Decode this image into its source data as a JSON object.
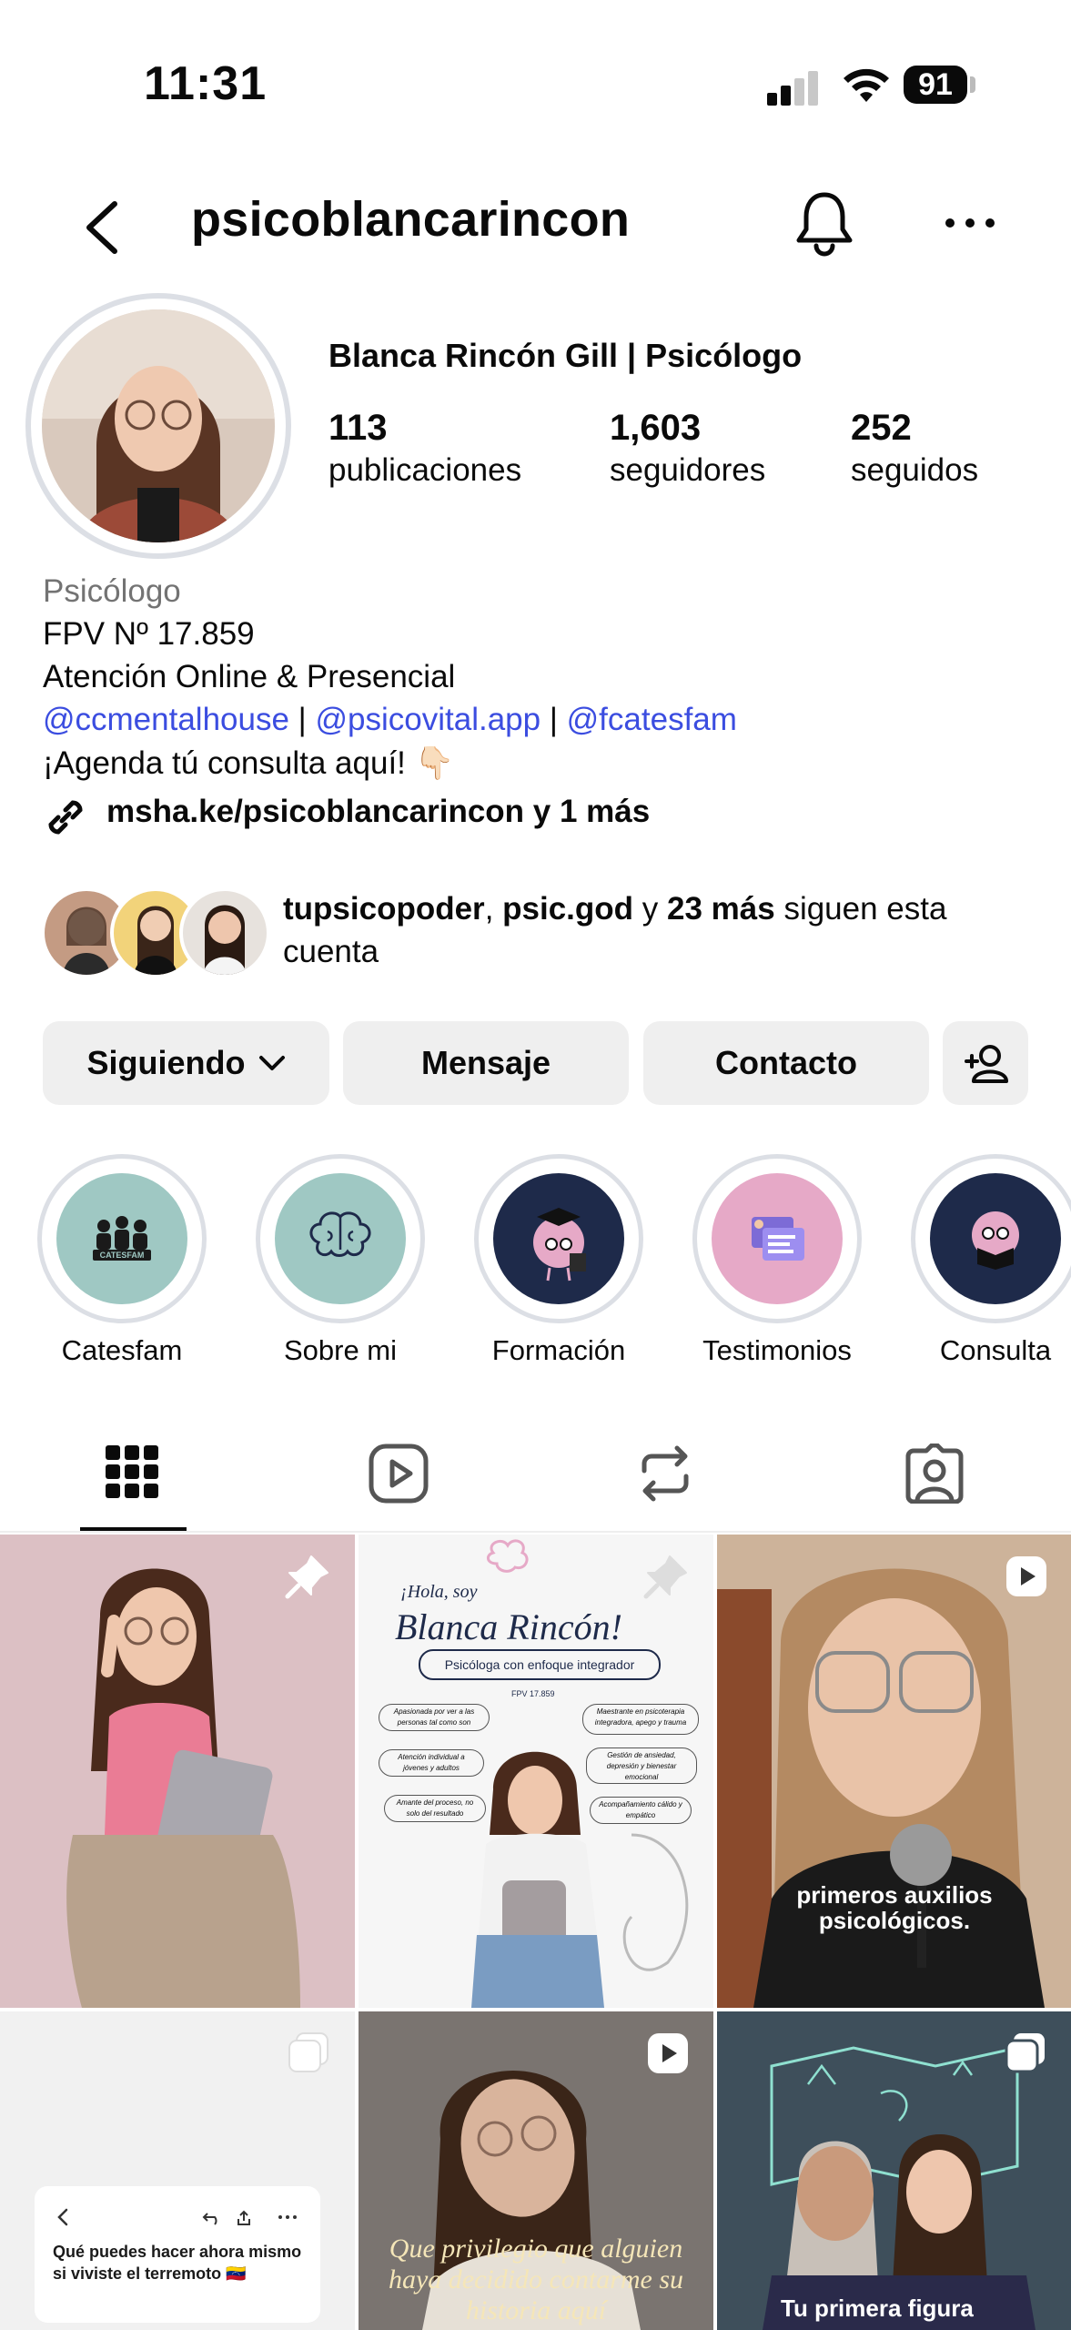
{
  "status_bar": {
    "time": "11:31",
    "battery": "91"
  },
  "header": {
    "username": "psicoblancarincon"
  },
  "profile": {
    "display_name": "Blanca Rincón Gill | Psicólogo",
    "stats": [
      {
        "value": "113",
        "label": "publicaciones"
      },
      {
        "value": "1,603",
        "label": "seguidores"
      },
      {
        "value": "252",
        "label": "seguidos"
      }
    ],
    "category": "Psicólogo",
    "bio_lines": [
      "FPV Nº 17.859",
      "Atención Online & Presencial"
    ],
    "mentions": [
      "@ccmentalhouse",
      "@psicovital.app",
      "@fcatesfam"
    ],
    "mention_sep": " | ",
    "bio_cta": "¡Agenda tú consulta aquí! 👇🏻",
    "link": "msha.ke/psicoblancarincon y 1 más"
  },
  "followed_by": {
    "name1": "tupsicopoder",
    "sep1": ", ",
    "name2": "psic.god",
    "sep2": " y ",
    "more": "23 más",
    "suffix": " siguen esta cuenta"
  },
  "actions": {
    "following": "Siguiendo",
    "message": "Mensaje",
    "contact": "Contacto"
  },
  "highlights": [
    {
      "label": "Catesfam",
      "badge": "CATESFAM"
    },
    {
      "label": "Sobre mi"
    },
    {
      "label": "Formación"
    },
    {
      "label": "Testimonios"
    },
    {
      "label": "Consulta"
    }
  ],
  "tabs": [
    "grid-icon",
    "reels-icon",
    "reposts-icon",
    "tagged-icon"
  ],
  "posts": {
    "p2": {
      "hello": "¡Hola, soy",
      "name": "Blanca Rincón!",
      "subtitle": "Psicóloga con enfoque integrador",
      "fpv": "FPV 17.859",
      "bubbles": [
        "Apasionada por ver a las personas tal como son",
        "Maestrante en psicoterapia integradora, apego y trauma",
        "Atención individual a jóvenes y adultos",
        "Gestión de ansiedad, depresión y bienestar emocional",
        "Amante del proceso, no solo del resultado",
        "Acompañamiento cálido y empático"
      ]
    },
    "p3": {
      "caption": "primeros auxilios psicológicos."
    },
    "p4": {
      "caption": "Qué puedes hacer ahora mismo si viviste el terremoto 🇻🇪"
    },
    "p5": {
      "caption": "Que privilegio que alguien haya decidido contarme su historia aquí"
    },
    "p6": {
      "caption": "Tu primera figura"
    }
  },
  "colors": {
    "accent_link": "#3b4de0",
    "button_bg": "#efefef",
    "highlight_teal": "#9fc8c3",
    "highlight_navy": "#1e2a4a",
    "highlight_pink": "#e6a9c7"
  }
}
